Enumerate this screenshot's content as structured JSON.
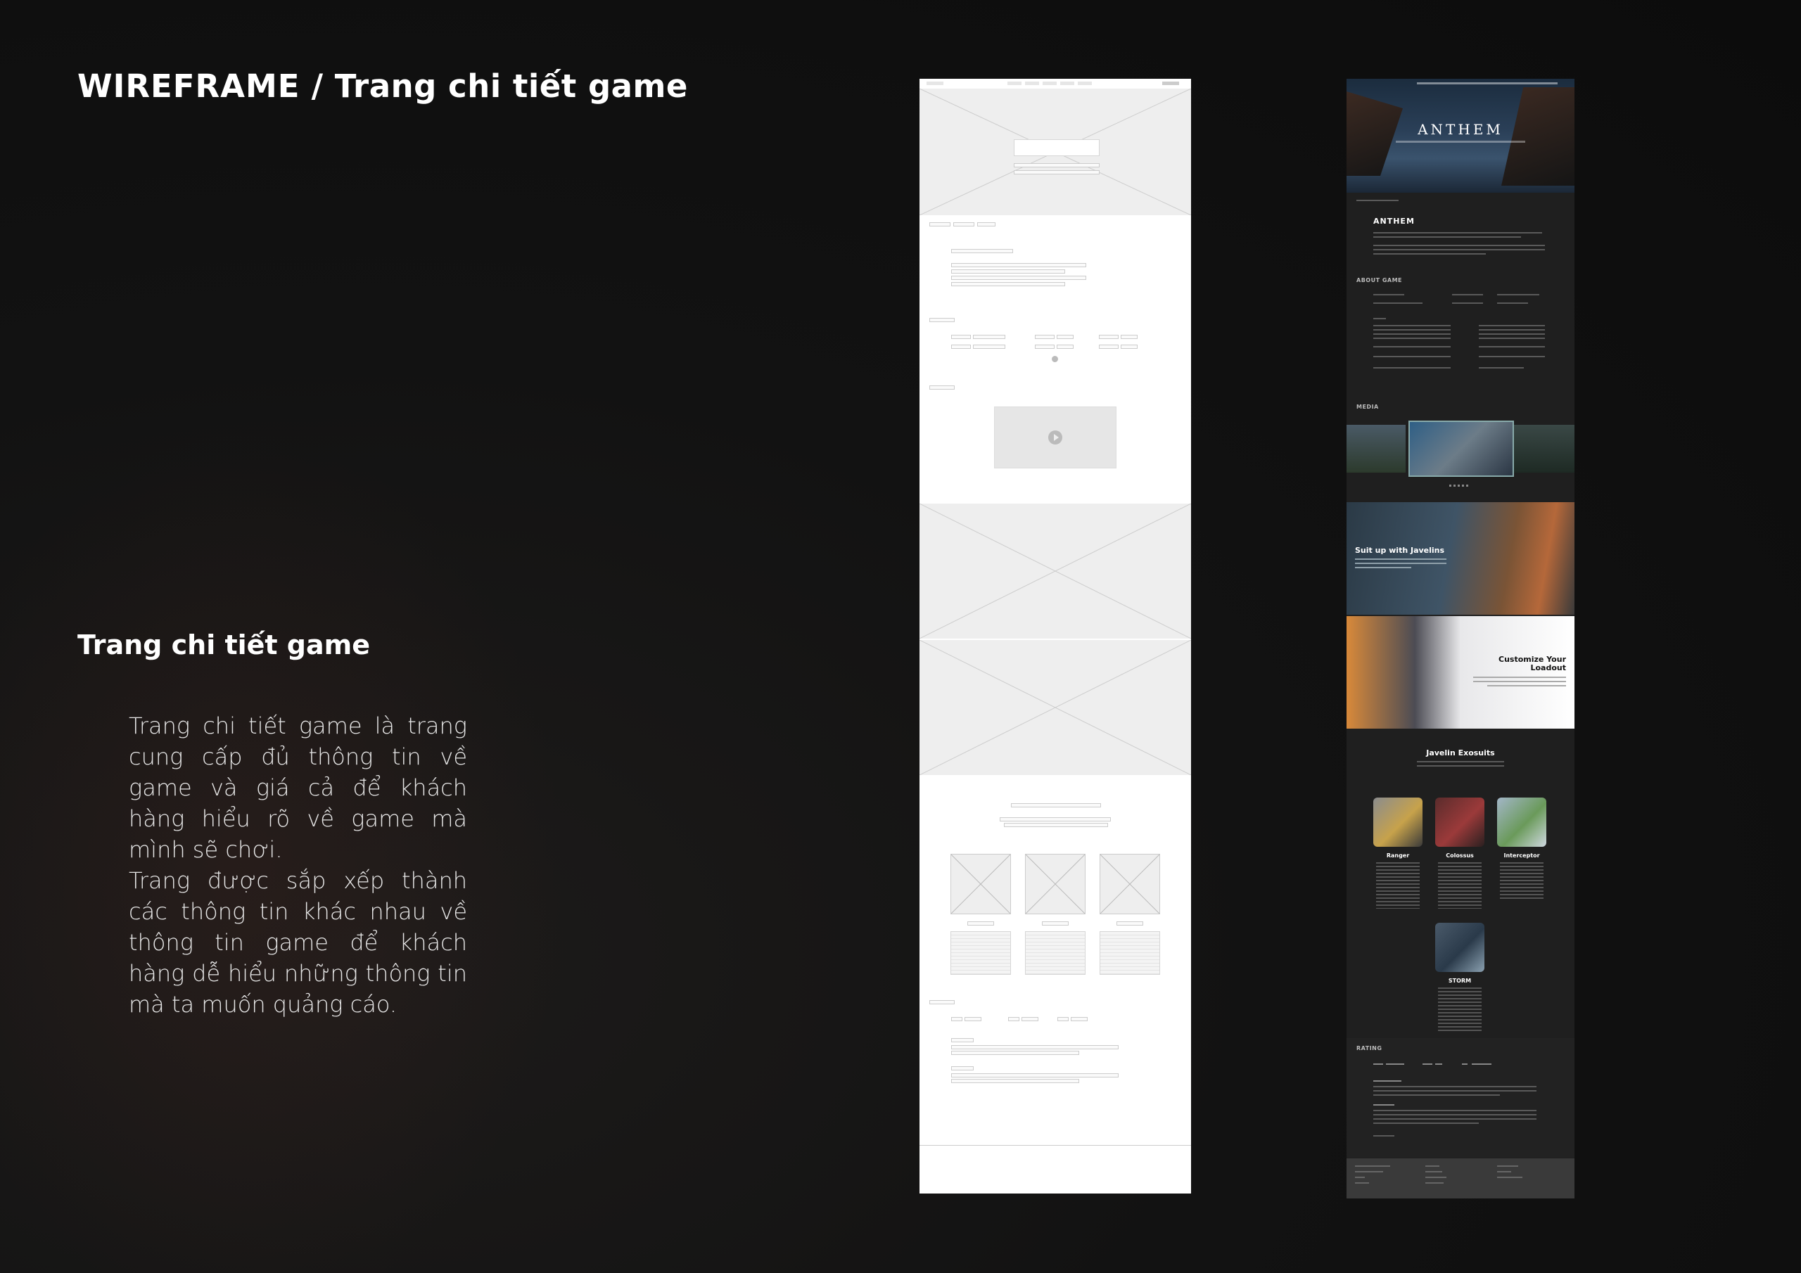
{
  "page": {
    "heading_lead": "WIREFRAME",
    "heading_sep": " / ",
    "heading_rest": "Trang chi tiết game",
    "section_title": "Trang chi tiết game",
    "description": [
      "Trang chi tiết game là trang cung cấp đủ thông tin về game và giá cả để khách hàng hiểu rõ về game mà mình sẽ chơi.",
      "Trang được sắp xếp thành các thông tin khác nhau về thông tin game để khách hàng dễ hiểu những thông tin mà ta muốn quảng cáo."
    ]
  },
  "design": {
    "hero_logo": "ANTHEM",
    "game_title": "ANTHEM",
    "about_label": "ABOUT GAME",
    "media_label": "MEDIA",
    "banner1_title": "Suit up with Javelins",
    "banner2_title": "Customize Your Loadout",
    "exosuits_title": "Javelin Exosuits",
    "classes": [
      "Ranger",
      "Colossus",
      "Interceptor",
      "STORM"
    ],
    "rating_label": "RATING",
    "colors": {
      "background": "#121212",
      "mockup_bg": "#1f1f1f",
      "wireframe_bg": "#ffffff",
      "accent": "#d9812c"
    }
  }
}
